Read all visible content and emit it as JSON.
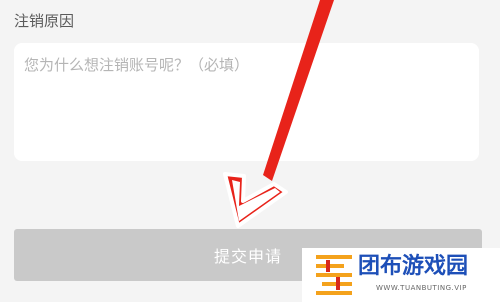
{
  "form": {
    "reason_label": "注销原因",
    "reason_placeholder": "您为什么想注销账号呢？（必填）",
    "reason_value": "",
    "submit_label": "提交申请"
  },
  "annotation": {
    "arrow_color": "#e8231a"
  },
  "watermark": {
    "brand": "团布游戏园",
    "url": "WWW.TUANBUTING.VIP",
    "logo_icon": "striped-square-logo"
  },
  "colors": {
    "background": "#f4f4f4",
    "button_disabled": "#c9c9c9",
    "brand_blue": "#1d4fb8"
  }
}
